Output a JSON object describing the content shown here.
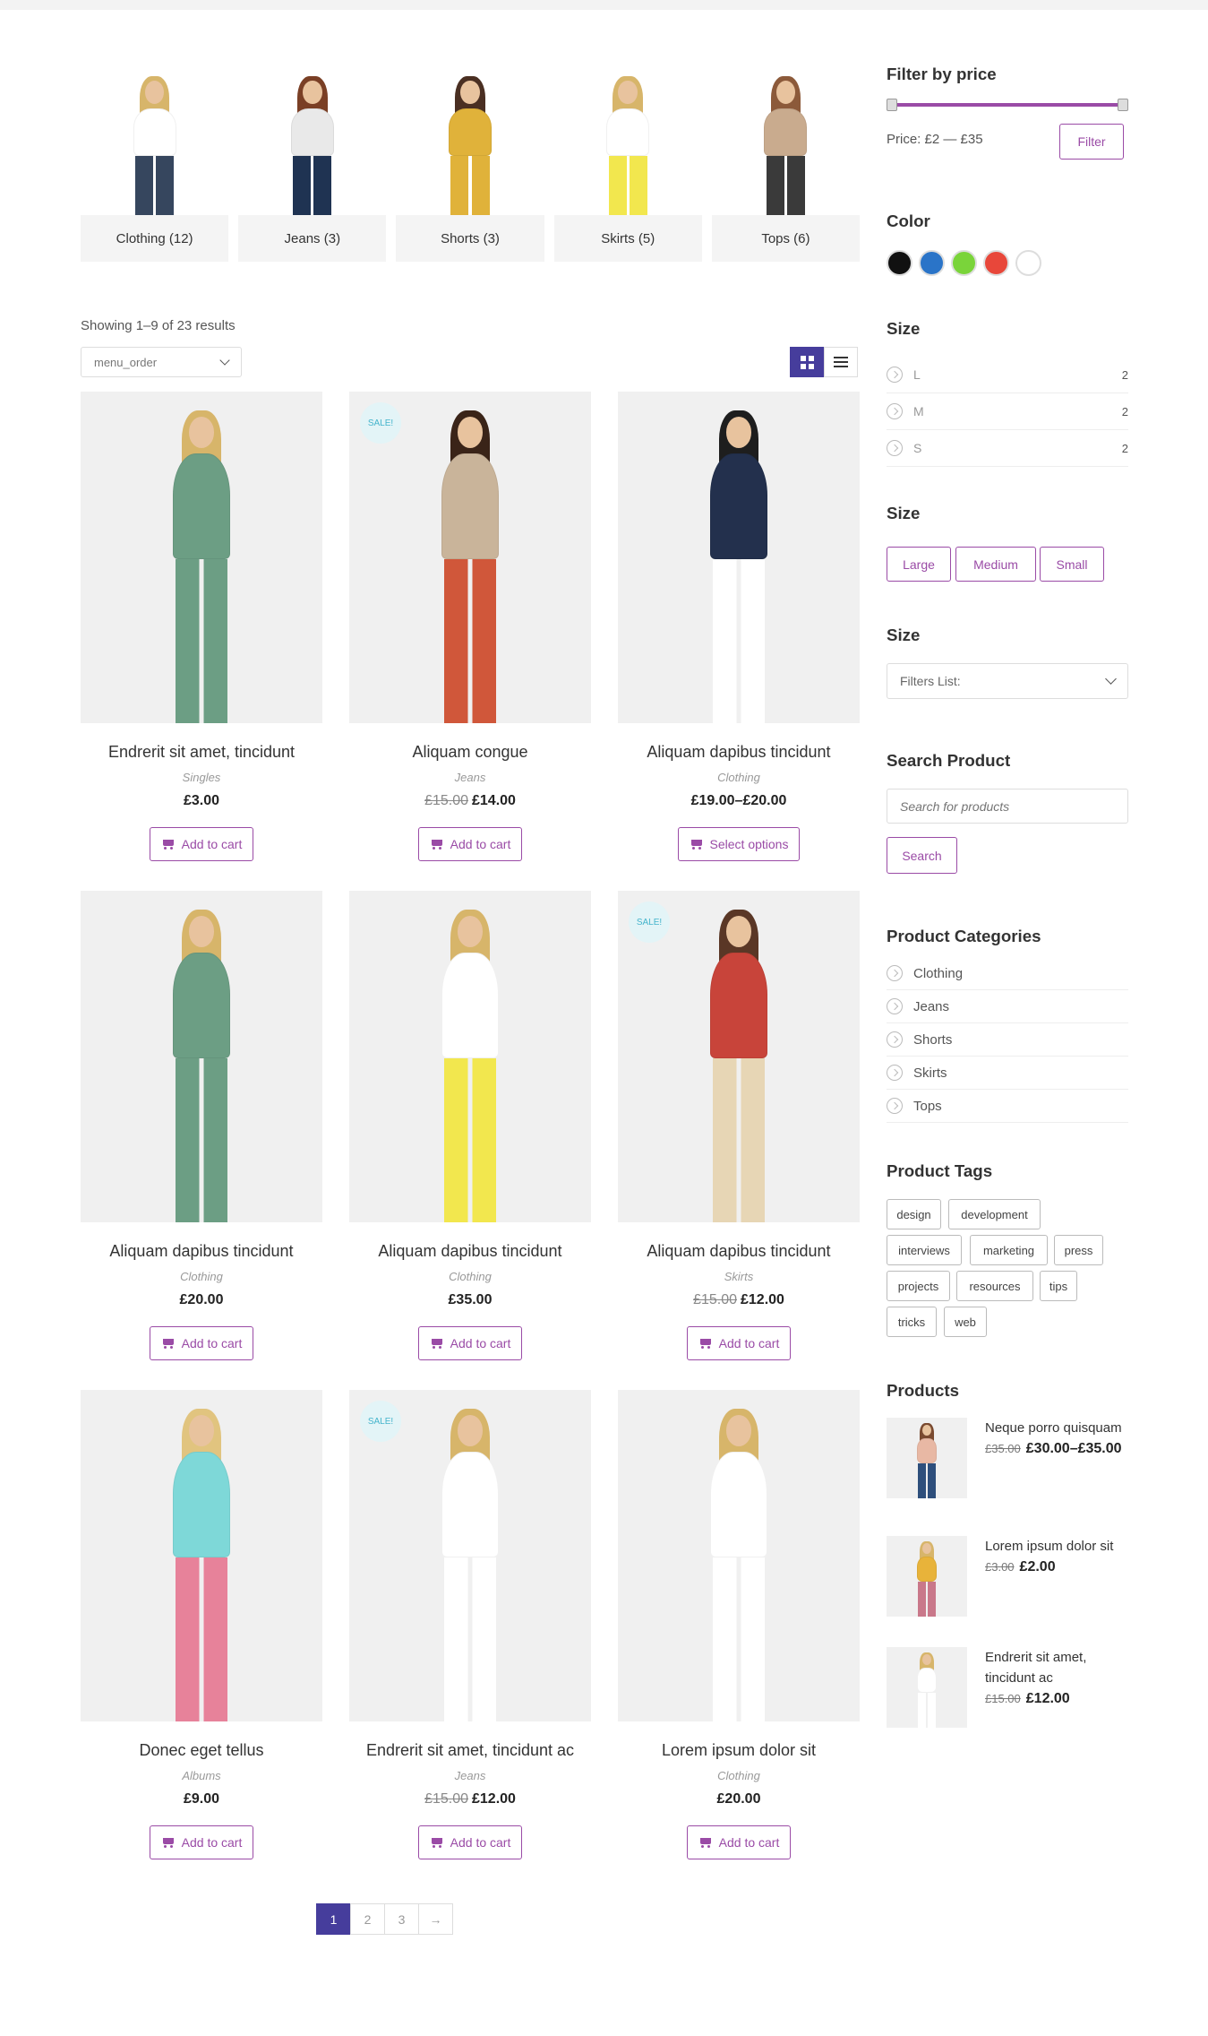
{
  "categories": [
    {
      "label": "Clothing (12)",
      "colors": {
        "hair": "#d7b56a",
        "top": "#ffffff",
        "bottom": "#36465e",
        "skin": "#e8c39e"
      }
    },
    {
      "label": "Jeans (3)",
      "colors": {
        "hair": "#7a3f25",
        "top": "#e9e9e9",
        "bottom": "#1f3352",
        "skin": "#e8c39e"
      }
    },
    {
      "label": "Shorts (3)",
      "colors": {
        "hair": "#4a2f22",
        "top": "#e0b23a",
        "bottom": "#e0b23a",
        "skin": "#e8c39e"
      }
    },
    {
      "label": "Skirts (5)",
      "colors": {
        "hair": "#d7b56a",
        "top": "#ffffff",
        "bottom": "#f2e74e",
        "skin": "#e8c39e"
      }
    },
    {
      "label": "Tops (6)",
      "colors": {
        "hair": "#8c5a3a",
        "top": "#c9ab8e",
        "bottom": "#3a3a3a",
        "skin": "#e8c39e"
      }
    }
  ],
  "results": {
    "text": "Showing 1–9 of 23 results"
  },
  "sort": {
    "value": "menu_order"
  },
  "products": [
    {
      "name": "Endrerit sit amet, tincidunt",
      "category": "Singles",
      "old": "",
      "price": "£3.00",
      "button": "Add to cart",
      "sale": false,
      "colors": {
        "hair": "#d7b56a",
        "top": "#6c9e84",
        "bottom": "#6c9e84"
      }
    },
    {
      "name": "Aliquam congue",
      "category": "Jeans",
      "old": "£15.00",
      "price": "£14.00",
      "button": "Add to cart",
      "sale": true,
      "colors": {
        "hair": "#3a2418",
        "top": "#c9b49a",
        "bottom": "#d0573a"
      }
    },
    {
      "name": "Aliquam dapibus tincidunt",
      "category": "Clothing",
      "old": "",
      "price": "£19.00–£20.00",
      "button": "Select options",
      "sale": false,
      "colors": {
        "hair": "#1e1e1e",
        "top": "#23304d",
        "bottom": "#ffffff"
      }
    },
    {
      "name": "Aliquam dapibus tincidunt",
      "category": "Clothing",
      "old": "",
      "price": "£20.00",
      "button": "Add to cart",
      "sale": false,
      "colors": {
        "hair": "#d7b56a",
        "top": "#6c9e84",
        "bottom": "#6c9e84"
      }
    },
    {
      "name": "Aliquam dapibus tincidunt",
      "category": "Clothing",
      "old": "",
      "price": "£35.00",
      "button": "Add to cart",
      "sale": false,
      "colors": {
        "hair": "#d7b56a",
        "top": "#ffffff",
        "bottom": "#f2e74e"
      }
    },
    {
      "name": "Aliquam dapibus tincidunt",
      "category": "Skirts",
      "old": "£15.00",
      "price": "£12.00",
      "button": "Add to cart",
      "sale": true,
      "colors": {
        "hair": "#5a3726",
        "top": "#c8443a",
        "bottom": "#e7d6b5"
      }
    },
    {
      "name": "Donec eget tellus",
      "category": "Albums",
      "old": "",
      "price": "£9.00",
      "button": "Add to cart",
      "sale": false,
      "colors": {
        "hair": "#e1c47f",
        "top": "#7ed8d8",
        "bottom": "#e7829a"
      }
    },
    {
      "name": "Endrerit sit amet, tincidunt ac",
      "category": "Jeans",
      "old": "£15.00",
      "price": "£12.00",
      "button": "Add to cart",
      "sale": true,
      "colors": {
        "hair": "#d7b56a",
        "top": "#ffffff",
        "bottom": "#ffffff"
      }
    },
    {
      "name": "Lorem ipsum dolor sit",
      "category": "Clothing",
      "old": "",
      "price": "£20.00",
      "button": "Add to cart",
      "sale": false,
      "colors": {
        "hair": "#d7b56a",
        "top": "#ffffff",
        "bottom": "#ffffff"
      }
    }
  ],
  "sale_label": "SALE!",
  "pagination": [
    "1",
    "2",
    "3",
    "→"
  ],
  "sidebar": {
    "price": {
      "title": "Filter by price",
      "text": "Price: £2 — £35",
      "button": "Filter"
    },
    "color": {
      "title": "Color",
      "swatches": [
        "#111111",
        "#2a74c8",
        "#7ad43a",
        "#e8473a",
        "#ffffff"
      ]
    },
    "size1": {
      "title": "Size",
      "items": [
        {
          "label": "L",
          "count": "2"
        },
        {
          "label": "M",
          "count": "2"
        },
        {
          "label": "S",
          "count": "2"
        }
      ]
    },
    "size2": {
      "title": "Size",
      "buttons": [
        "Large",
        "Medium",
        "Small"
      ]
    },
    "size3": {
      "title": "Size",
      "select": "Filters List:"
    },
    "search": {
      "title": "Search Product",
      "placeholder": "Search for products",
      "button": "Search"
    },
    "categories": {
      "title": "Product Categories",
      "items": [
        "Clothing",
        "Jeans",
        "Shorts",
        "Skirts",
        "Tops"
      ]
    },
    "tags": {
      "title": "Product Tags",
      "items": [
        "design",
        "development",
        "interviews",
        "marketing",
        "press",
        "projects",
        "resources",
        "tips",
        "tricks",
        "web"
      ]
    },
    "products": {
      "title": "Products",
      "items": [
        {
          "name": "Neque porro quisquam",
          "old": "£35.00",
          "price": "£30.00–£35.00",
          "colors": {
            "hair": "#7a4a30",
            "top": "#e8b8a4",
            "bottom": "#2e4f7c"
          }
        },
        {
          "name": "Lorem ipsum dolor sit",
          "old": "£3.00",
          "price": "£2.00",
          "colors": {
            "hair": "#d7b56a",
            "top": "#e8b33a",
            "bottom": "#c9788a"
          }
        },
        {
          "name": "Endrerit sit amet, tincidunt ac",
          "old": "£15.00",
          "price": "£12.00",
          "colors": {
            "hair": "#d7b56a",
            "top": "#ffffff",
            "bottom": "#ffffff"
          }
        }
      ]
    }
  }
}
